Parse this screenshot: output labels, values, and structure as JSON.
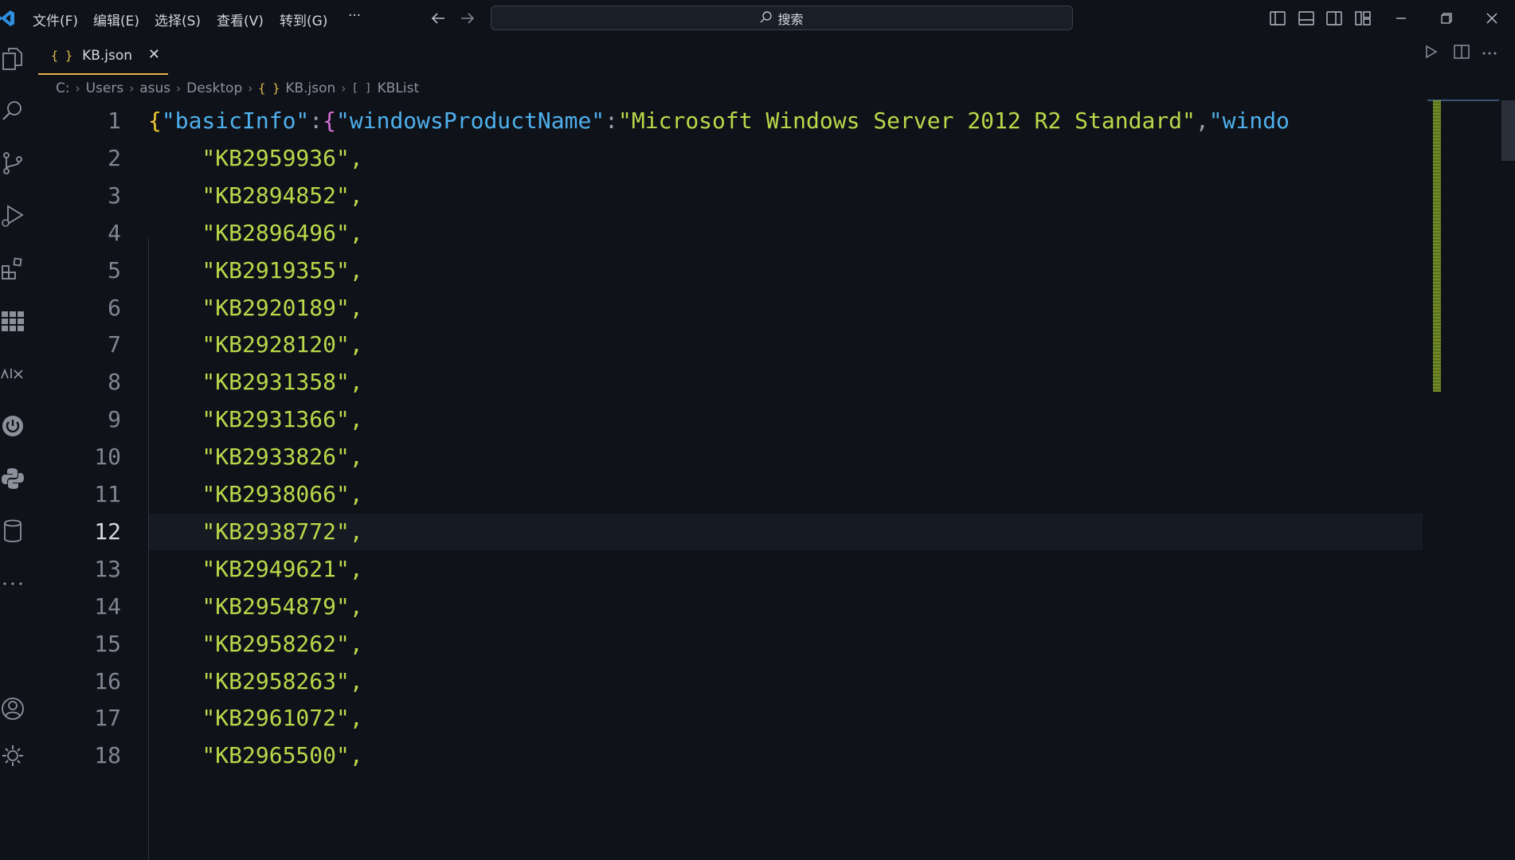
{
  "titlebar": {
    "menu": [
      "文件(F)",
      "编辑(E)",
      "选择(S)",
      "查看(V)",
      "转到(G)"
    ],
    "more": "···",
    "search_placeholder": "搜索"
  },
  "tab": {
    "icon_text": "{ }",
    "label": "KB.json",
    "close": "✕"
  },
  "breadcrumb": {
    "parts": [
      "C:",
      "Users",
      "asus",
      "Desktop"
    ],
    "file_icon": "{ }",
    "file": "KB.json",
    "symbol_icon": "[ ]",
    "symbol": "KBList"
  },
  "editor": {
    "current_line": 12,
    "line1": {
      "num": "1",
      "brace1": "{",
      "key1": "\"basicInfo\"",
      "colon1": ":",
      "brace2": "{",
      "key2": "\"windowsProductName\"",
      "colon2": ":",
      "value": "\"Microsoft Windows Server 2012 R2 Standard\"",
      "comma": ",",
      "key3": "\"windo"
    },
    "lines": [
      {
        "num": "2",
        "text": "    \"KB2959936\","
      },
      {
        "num": "3",
        "text": "    \"KB2894852\","
      },
      {
        "num": "4",
        "text": "    \"KB2896496\","
      },
      {
        "num": "5",
        "text": "    \"KB2919355\","
      },
      {
        "num": "6",
        "text": "    \"KB2920189\","
      },
      {
        "num": "7",
        "text": "    \"KB2928120\","
      },
      {
        "num": "8",
        "text": "    \"KB2931358\","
      },
      {
        "num": "9",
        "text": "    \"KB2931366\","
      },
      {
        "num": "10",
        "text": "    \"KB2933826\","
      },
      {
        "num": "11",
        "text": "    \"KB2938066\","
      },
      {
        "num": "12",
        "text": "    \"KB2938772\","
      },
      {
        "num": "13",
        "text": "    \"KB2949621\","
      },
      {
        "num": "14",
        "text": "    \"KB2954879\","
      },
      {
        "num": "15",
        "text": "    \"KB2958262\","
      },
      {
        "num": "16",
        "text": "    \"KB2958263\","
      },
      {
        "num": "17",
        "text": "    \"KB2961072\","
      },
      {
        "num": "18",
        "text": "    \"KB2965500\","
      }
    ]
  },
  "colors": {
    "background": "#0f1219",
    "string": "#b9d94a",
    "key": "#4fb0ec",
    "brace_level1": "#f1c832",
    "brace_level2": "#d670d6",
    "tab_accent": "#e2b34a"
  }
}
